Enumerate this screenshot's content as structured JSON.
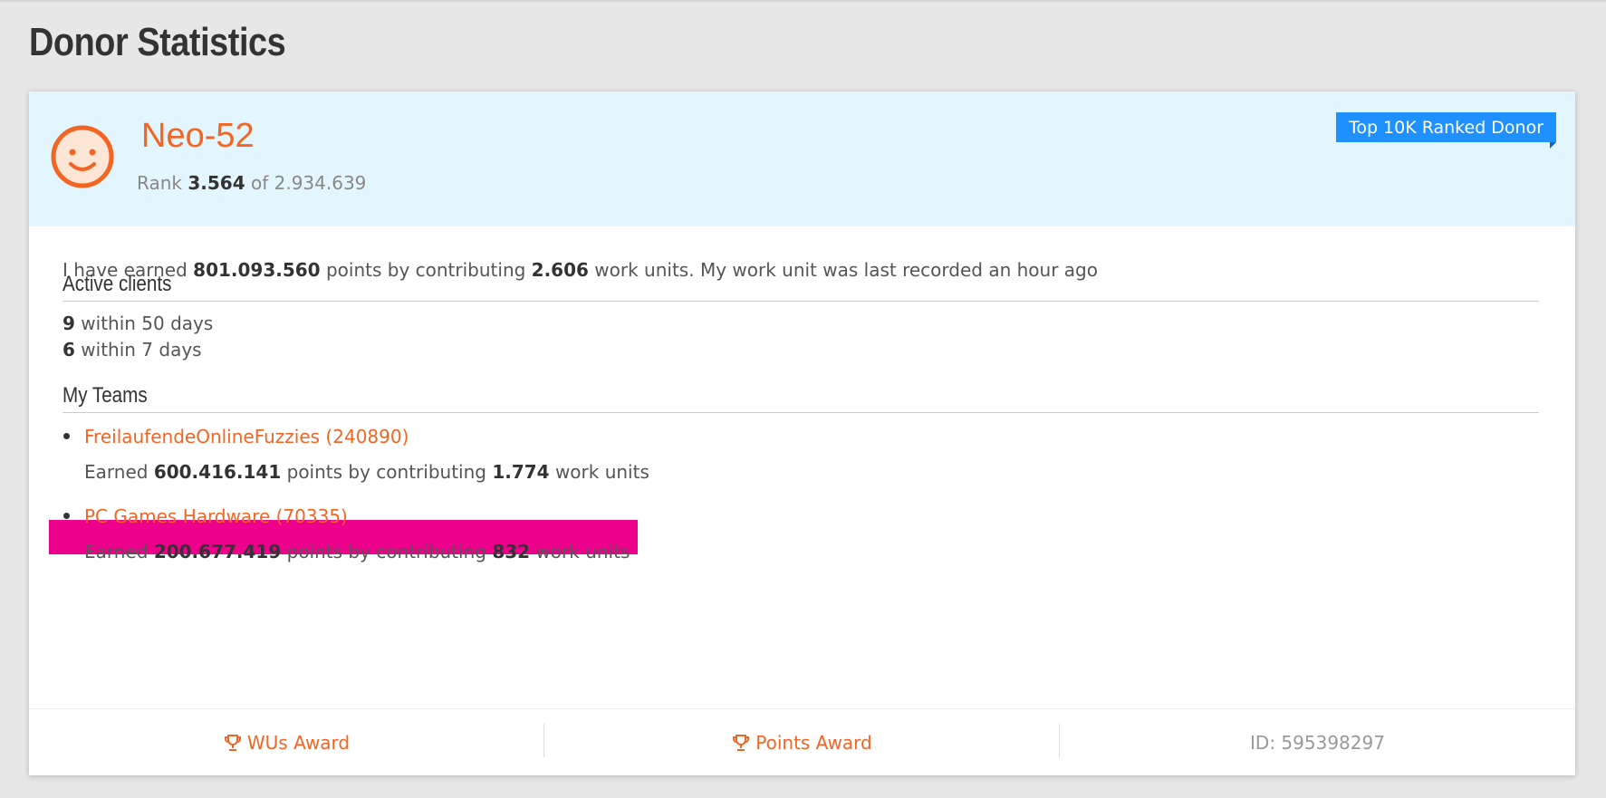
{
  "page": {
    "title": "Donor Statistics"
  },
  "donor": {
    "name": "Neo-52",
    "rank_prefix": "Rank",
    "rank": "3.564",
    "rank_of": "of",
    "rank_total": "2.934.639",
    "badge": "Top 10K Ranked Donor"
  },
  "summary": {
    "p1": "I have earned",
    "points": "801.093.560",
    "p2": "points by contributing",
    "work_units": "2.606",
    "p3": "work units. My work unit was last recorded an hour ago"
  },
  "active_clients": {
    "title": "Active clients",
    "rows": [
      {
        "count": "9",
        "label": "within 50 days"
      },
      {
        "count": "6",
        "label": "within 7 days"
      }
    ]
  },
  "teams": {
    "title": "My Teams",
    "items": [
      {
        "name": "FreilaufendeOnlineFuzzies (240890)",
        "earned": "Earned",
        "points": "600.416.141",
        "mid": "points by contributing",
        "work_units": "1.774",
        "suffix": "work units"
      },
      {
        "name": "PC Games Hardware (70335)",
        "earned": "Earned",
        "points": "200.677.419",
        "mid": "points by contributing",
        "work_units": "832",
        "suffix": "work units"
      }
    ]
  },
  "footer": {
    "wus_award": "WUs Award",
    "points_award": "Points Award",
    "id": "ID: 595398297"
  },
  "colors": {
    "accent": "#f26522",
    "header_bg": "#e3f5fd",
    "badge_bg": "#1e90ff",
    "highlight": "#ec008c"
  },
  "icons": {
    "avatar": "smiley-face-icon",
    "award": "trophy-icon"
  }
}
